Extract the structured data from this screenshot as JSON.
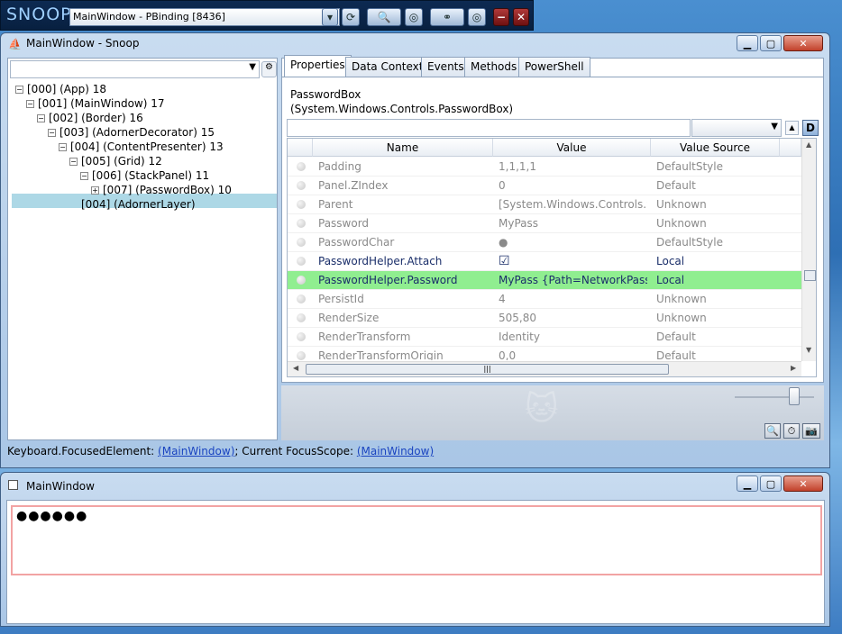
{
  "snoop_toolbar": {
    "logo": "SNOOP",
    "window_select": "MainWindow - PBinding [8436]"
  },
  "snoop_window": {
    "title": "MainWindow - Snoop"
  },
  "tree": [
    {
      "label": "[000]  (App) 18",
      "toggle": "⊟"
    },
    {
      "label": "[001]  (MainWindow) 17",
      "toggle": "⊟"
    },
    {
      "label": "[002]  (Border) 16",
      "toggle": "⊟"
    },
    {
      "label": "[003]  (AdornerDecorator) 15",
      "toggle": "⊟"
    },
    {
      "label": "[004]  (ContentPresenter) 13",
      "toggle": "⊟"
    },
    {
      "label": "[005]  (Grid) 12",
      "toggle": "⊟"
    },
    {
      "label": "[006]  (StackPanel) 11",
      "toggle": "⊟"
    },
    {
      "label": "[007]  (PasswordBox) 10",
      "toggle": "⊞"
    },
    {
      "label": "[004]  (AdornerLayer)",
      "toggle": ""
    }
  ],
  "tabs": [
    "Properties",
    "Data Context",
    "Events",
    "Methods",
    "PowerShell"
  ],
  "selected": {
    "type": "PasswordBox",
    "full_type": "(System.Windows.Controls.PasswordBox)"
  },
  "grid": {
    "headers": [
      "Name",
      "Value",
      "Value Source"
    ],
    "rows": [
      {
        "name": "Padding",
        "value": "1,1,1,1",
        "source": "DefaultStyle",
        "style": "gray"
      },
      {
        "name": "Panel.ZIndex",
        "value": "0",
        "source": "Default",
        "style": "gray"
      },
      {
        "name": "Parent",
        "value": "[System.Windows.Controls.StackPanel]",
        "source": "Unknown",
        "style": "gray"
      },
      {
        "name": "Password",
        "value": "MyPass",
        "source": "Unknown",
        "style": "gray"
      },
      {
        "name": "PasswordChar",
        "value": "●",
        "source": "DefaultStyle",
        "style": "gray"
      },
      {
        "name": "PasswordHelper.Attach",
        "value": "☑",
        "source": "Local",
        "style": "navy"
      },
      {
        "name": "PasswordHelper.Password",
        "value": "MyPass {Path=NetworkPassword}",
        "source": "Local",
        "style": "navy hl"
      },
      {
        "name": "PersistId",
        "value": "4",
        "source": "Unknown",
        "style": "gray"
      },
      {
        "name": "RenderSize",
        "value": "505,80",
        "source": "Unknown",
        "style": "gray"
      },
      {
        "name": "RenderTransform",
        "value": "Identity",
        "source": "Default",
        "style": "gray"
      },
      {
        "name": "RenderTransformOrigin",
        "value": "0,0",
        "source": "Default",
        "style": "gray"
      }
    ]
  },
  "status": {
    "prefix": "Keyboard.FocusedElement: ",
    "focused": "(MainWindow)",
    "mid": "; Current FocusScope: ",
    "scope": "(MainWindow)"
  },
  "main_window": {
    "title": "MainWindow",
    "password_mask": "●●●●●●"
  },
  "icons": [
    "dropdown-arrow-icon",
    "refresh-icon",
    "magnifier-icon",
    "target-icon",
    "binoculars-icon",
    "minimize-icon",
    "close-icon",
    "search-icon",
    "timer-icon",
    "camera-icon"
  ]
}
